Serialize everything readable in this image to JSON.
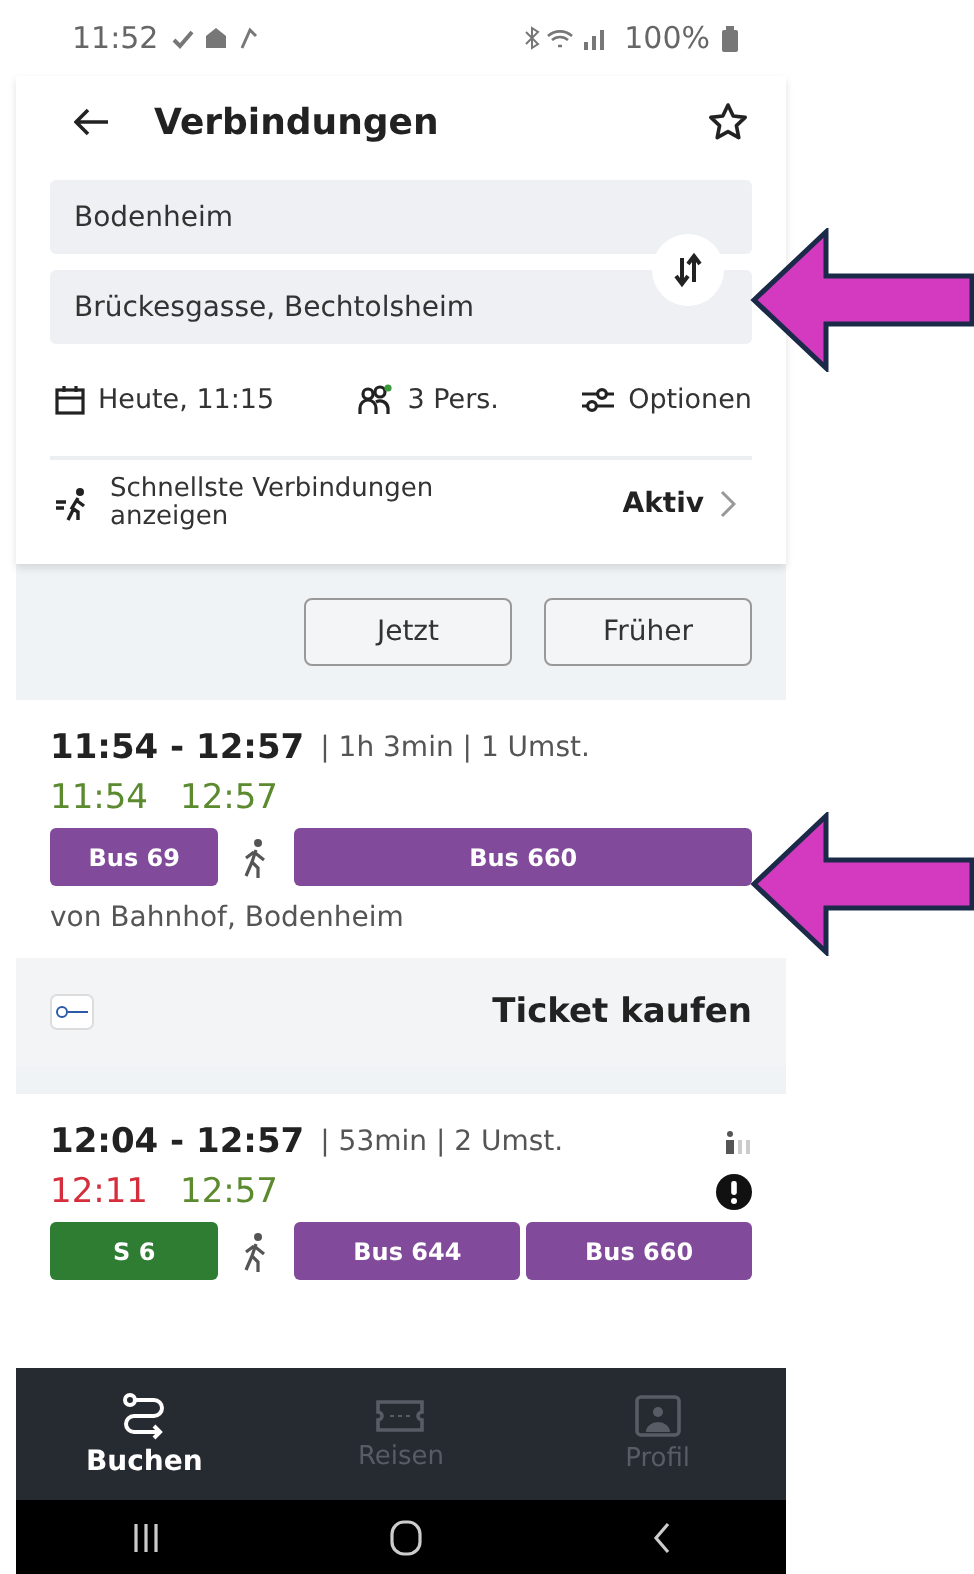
{
  "status_bar": {
    "time": "11:52",
    "battery": "100%"
  },
  "header": {
    "title": "Verbindungen"
  },
  "route": {
    "from": "Bodenheim",
    "to": "Brückesgasse, Bechtolsheim"
  },
  "options": [
    {
      "kind": "date",
      "label": "Heute, 11:15"
    },
    {
      "kind": "persons",
      "label": "3 Pers."
    },
    {
      "kind": "options",
      "label": "Optionen"
    }
  ],
  "fastest": {
    "label": "Schnellste Verbindungen anzeigen",
    "value": "Aktiv"
  },
  "time_buttons": [
    "Jetzt",
    "Früher"
  ],
  "connections": [
    {
      "time_range": "11:54 - 12:57",
      "meta": "| 1h 3min | 1 Umst.",
      "realtime": [
        {
          "time": "11:54",
          "delayed": false
        },
        {
          "time": "12:57",
          "delayed": false
        }
      ],
      "occupancy_icon": false,
      "alert": false,
      "legs": [
        {
          "kind": "line",
          "label": "Bus 69",
          "color": "#814a9a"
        },
        {
          "kind": "walk"
        },
        {
          "kind": "line",
          "label": "Bus 660",
          "color": "#814a9a"
        }
      ],
      "origin": "von Bahnhof, Bodenheim",
      "ticket": "Ticket kaufen"
    },
    {
      "time_range": "12:04 - 12:57",
      "meta": "| 53min | 2 Umst.",
      "realtime": [
        {
          "time": "12:11",
          "delayed": true
        },
        {
          "time": "12:57",
          "delayed": false
        }
      ],
      "occupancy_icon": true,
      "alert": true,
      "legs": [
        {
          "kind": "line",
          "label": "S 6",
          "color": "#2e7d32"
        },
        {
          "kind": "walk"
        },
        {
          "kind": "line",
          "label": "Bus 644",
          "color": "#814a9a"
        },
        {
          "kind": "line",
          "label": "Bus 660",
          "color": "#814a9a"
        }
      ]
    }
  ],
  "bottom_nav": [
    {
      "kind": "route",
      "label": "Buchen",
      "selected": true
    },
    {
      "kind": "ticket",
      "label": "Reisen",
      "selected": false
    },
    {
      "kind": "profile",
      "label": "Profil",
      "selected": false
    }
  ],
  "annotations": [
    {
      "kind": "arrow"
    },
    {
      "kind": "arrow"
    }
  ]
}
